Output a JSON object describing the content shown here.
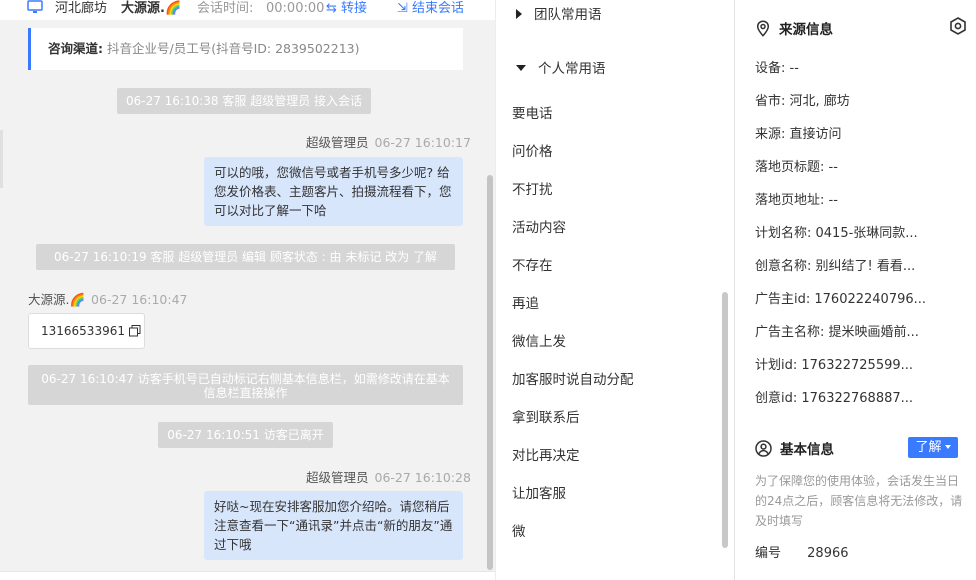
{
  "header": {
    "location": "河北廊坊",
    "customer_name": "大源源.🌈",
    "duration_label": "会话时间:",
    "duration": "00:00:00",
    "transfer_label": "转接",
    "end_label": "结束会话"
  },
  "channel": {
    "label": "咨询渠道:",
    "value": "抖音企业号/员工号(抖音号ID: 2839502213)"
  },
  "messages": {
    "sys1": "06-27 16:10:38 客服 超级管理员 接入会话",
    "agent1_name": "超级管理员",
    "agent1_time": "06-27 16:10:17",
    "agent1_text": "可以的哦，您微信号或者手机号多少呢? 给您发价格表、主题客片、拍摄流程看下，您可以对比了解一下哈",
    "sys2": "06-27 16:10:19 客服 超级管理员 编辑 顾客状态 : 由 未标记 改为 了解",
    "visitor_name": "大源源.🌈",
    "visitor_time": "06-27 16:10:47",
    "visitor_text": "13166533961",
    "sys3": "06-27 16:10:47 访客手机号已自动标记右侧基本信息栏，如需修改请在基本信息栏直接操作",
    "sys4": "06-27 16:10:51 访客已离开",
    "agent2_name": "超级管理员",
    "agent2_time": "06-27 16:10:28",
    "agent2_text": "好哒~现在安排客服加您介绍哈。请您稍后注意查看一下“通讯录”并点击“新的朋友”通过下哦"
  },
  "phrases": {
    "team_group": "团队常用语",
    "personal_group": "个人常用语",
    "items": [
      "要电话",
      "问价格",
      "不打扰",
      "活动内容",
      "不存在",
      "再追",
      "微信上发",
      "加客服时说自动分配",
      "拿到联系后",
      "对比再决定",
      "让加客服",
      "微"
    ]
  },
  "source": {
    "title": "来源信息",
    "rows": [
      "设备: --",
      "省市: 河北, 廊坊",
      "来源: 直接访问",
      "落地页标题: --",
      "落地页地址: --",
      "计划名称: 0415-张琳同款...",
      "创意名称: 别纠结了! 看看...",
      "广告主id: 176022240796...",
      "广告主名称: 提米映画婚前...",
      "计划id: 176322725599...",
      "创意id: 176322768887..."
    ]
  },
  "basic": {
    "title": "基本信息",
    "learn_label": "了解",
    "notice": "为了保障您的使用体验，会话发生当日的24点之后，顾客信息将无法修改，请及时填写",
    "id_label": "编号",
    "id_value": "28966"
  },
  "colors": {
    "accent": "#3a7afe",
    "bubble_agent": "#d8e6fc",
    "system_msg": "#d6d6d6"
  }
}
